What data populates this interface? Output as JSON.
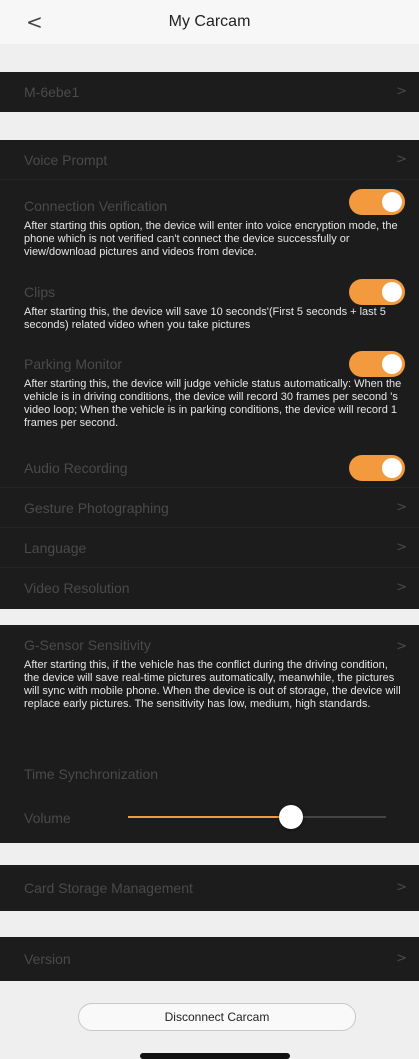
{
  "header": {
    "back_icon": "chevron-left",
    "title": "My Carcam"
  },
  "device": {
    "name": "M-6ebe1"
  },
  "settings": {
    "voice_prompt": "Voice Prompt",
    "connection_verification": {
      "label": "Connection Verification",
      "on": true,
      "description": "After starting this option, the device will enter into voice encryption mode, the phone which is not verified can't connect the device successfully or view/download pictures and videos from device."
    },
    "clips": {
      "label": "Clips",
      "on": true,
      "description": "After starting this, the device will save 10 seconds'(First 5 seconds + last 5 seconds) related video when you take pictures"
    },
    "parking_monitor": {
      "label": "Parking Monitor",
      "on": true,
      "description": "After starting this, the device will judge vehicle status automatically: When the vehicle is in driving conditions, the device will record 30 frames per second 's video loop; When the vehicle is in parking conditions, the device will record 1 frames per second."
    },
    "audio_recording": {
      "label": "Audio Recording",
      "on": true
    },
    "gesture_photographing": "Gesture Photographing",
    "language": "Language",
    "video_resolution": "Video Resolution"
  },
  "sensor": {
    "g_sensor": {
      "label": "G-Sensor Sensitivity",
      "description": "After starting this, if the vehicle has the conflict during the driving condition, the device will save real-time pictures automatically, meanwhile, the pictures will sync with mobile phone. When the device is out of storage, the device will replace early pictures. The sensitivity has low, medium, high standards."
    },
    "time_sync": "Time Synchronization",
    "volume": {
      "label": "Volume",
      "level": 0.63
    }
  },
  "storage": {
    "label": "Card Storage Management"
  },
  "version": {
    "label": "Version"
  },
  "disconnect_label": "Disconnect Carcam",
  "colors": {
    "accent": "#f39a3e",
    "panel": "#1c1c1c",
    "background": "#efefef"
  }
}
